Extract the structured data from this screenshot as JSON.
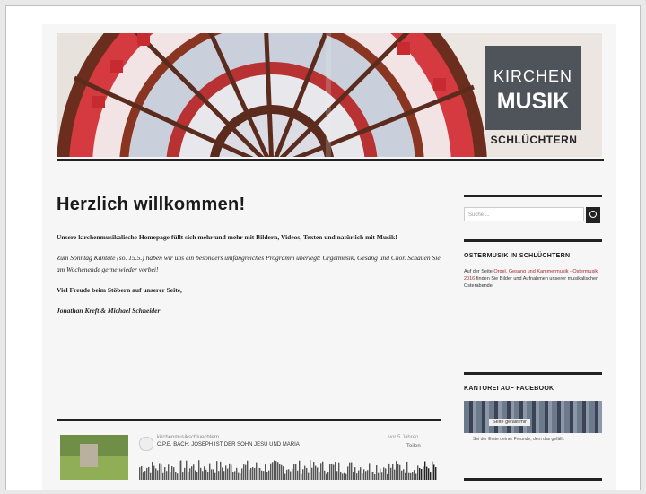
{
  "header": {
    "logo_line1": "KIRCHEN",
    "logo_line2": "MUSIK",
    "logo_sub": "SCHLÜCHTERN",
    "accent": "#c4262e"
  },
  "main": {
    "title": "Herzlich willkommen!",
    "paragraphs": [
      "Unsere kirchenmusikalische Homepage füllt sich mehr und mehr mit Bildern, Videos, Texten und natürlich mit Musik!",
      "Zum Sonntag Kantate (so. 15.5.) haben wir uns ein besonders umfangreiches Programm überlegt: Orgelmusik, Gesang und Chor. Schauen Sie am Wochenende gerne wieder vorbei!",
      "Viel Freude beim Stöbern auf unserer Seite,",
      "Jonathan Kreft & Michael Schneider"
    ]
  },
  "player": {
    "user": "kirchenmusikschluechtern",
    "title": "C.P.E. BACH: JOSEPH IST DER SOHN JESU UND MARIA",
    "date": "vor 5 Jahren",
    "share": "Teilen"
  },
  "sidebar": {
    "search_placeholder": "Suche ...",
    "widget1_title": "OSTERMUSIK IN SCHLÜCHTERN",
    "widget1_text_pre": "Auf der Seite",
    "widget1_link": "Orgel, Gesang und Kammermusik - Ostermusik 2016",
    "widget1_text_post": "finden Sie Bilder und Aufnahmen unserer musikalischen Osterabende.",
    "widget2_title": "KANTOREI AUF FACEBOOK",
    "fb_button": "Seite gefällt mir",
    "fb_text": "Sei der Erste deiner Freunde, dem das gefällt."
  }
}
